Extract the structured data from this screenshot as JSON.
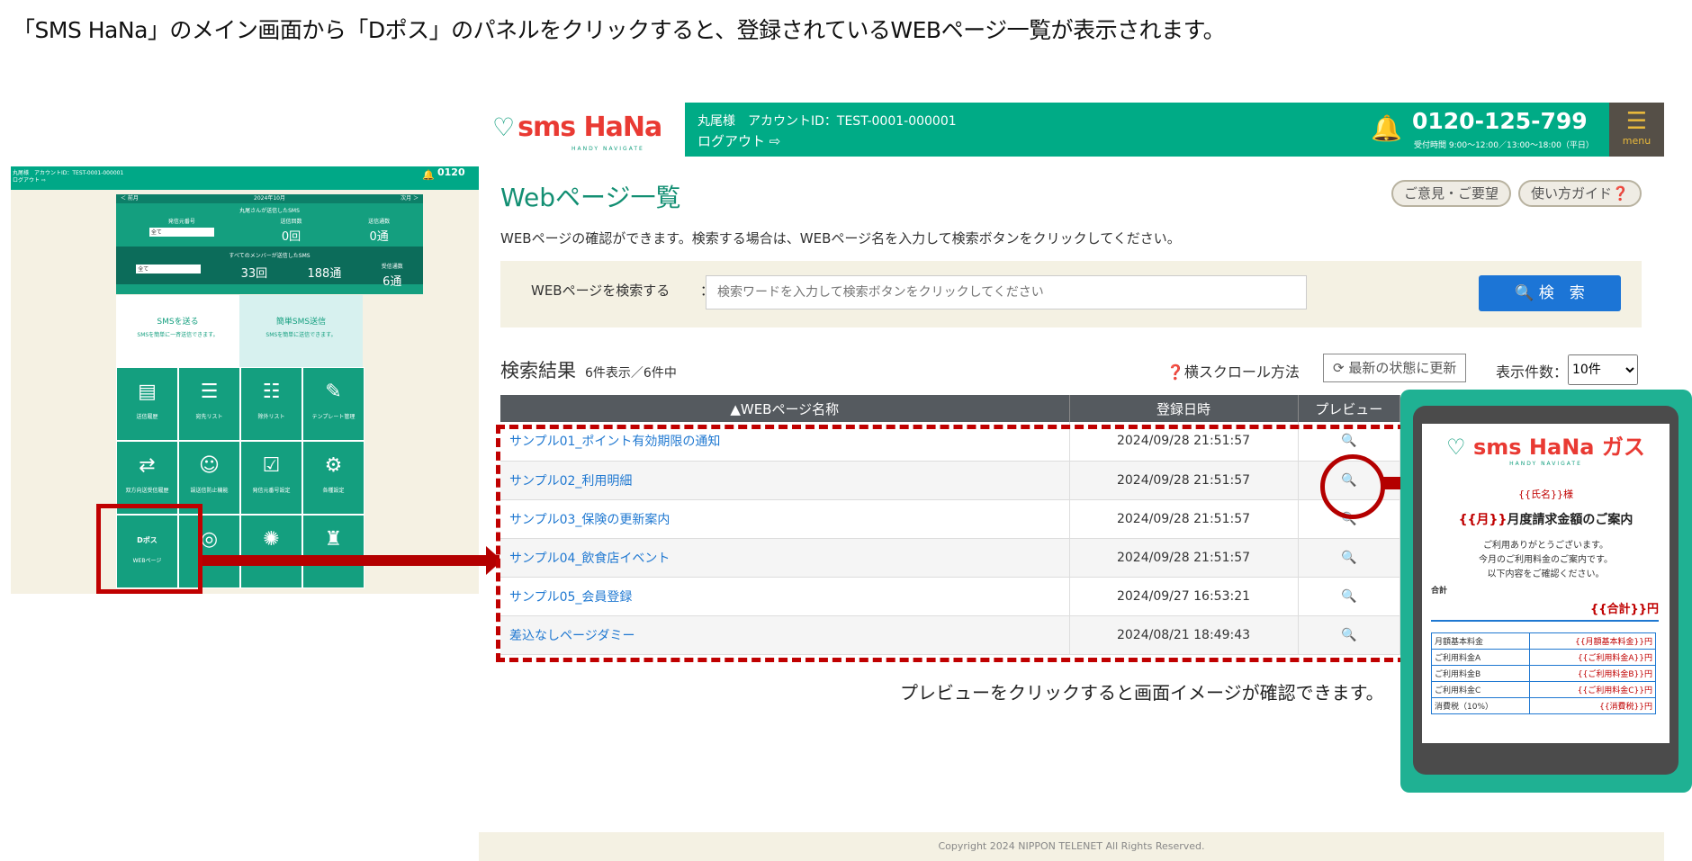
{
  "caption": "「SMS HaNa」のメイン画面から「Dポス」のパネルをクリックすると、登録されているWEBページ一覧が表示されます。",
  "left_panel": {
    "header_line1": "丸尾様　アカウントID：TEST-0001-000001",
    "header_line2": "ログアウト ⇨",
    "tel": "0120",
    "nav_prev": "＜ 前月",
    "nav_month": "2024年10月",
    "nav_next": "次月 ＞",
    "my_sms_title": "丸尾さんが送信したSMS",
    "sender_label": "発信元番号",
    "sender_value": "全て",
    "sent_count_label": "送信回数",
    "sent_count_value": "0回",
    "sent_msgs_label": "送信通数",
    "sent_msgs_value": "0通",
    "all_sms_title": "すべてのメンバーが送信したSMS",
    "all_sender_value": "全て",
    "all_sent_count_value": "33回",
    "all_sent_msgs_value": "188通",
    "all_received_label": "受信通数",
    "all_received_value": "6通",
    "tile_send_sms": "SMSを送る",
    "tile_send_sms_sub": "SMSを簡単に一斉送信できます。",
    "tile_easy_sms": "簡単SMS送信",
    "tile_easy_sms_sub": "SMSを簡単に送信できます。",
    "tiles": [
      "送信履歴",
      "宛先リスト",
      "除外リスト",
      "テンプレート管理",
      "双方向送受信履歴",
      "誤送信防止機能",
      "発信元番号設定",
      "各種設定",
      "WEBページ"
    ],
    "dpos_label": "Dポス"
  },
  "header": {
    "logo_text": "sms HaNa",
    "logo_sub": "HANDY NAVIGATE",
    "account": "丸尾様　アカウントID：TEST-0001-000001",
    "logout": "ログアウト ⇨",
    "tel": "0120-125-799",
    "hours": "受付時間 9:00〜12:00／13:00〜18:00（平日）",
    "menu": "menu"
  },
  "page": {
    "title": "Webページ一覧",
    "feedback_button": "ご意見・ご要望",
    "guide_button": "使い方ガイド❓",
    "description": "WEBページの確認ができます。検索する場合は、WEBページ名を入力して検索ボタンをクリックしてください。",
    "search_label": "WEBページを検索する",
    "search_colon": "：",
    "search_placeholder": "検索ワードを入力して検索ボタンをクリックしてください",
    "search_button": "🔍 検　索",
    "results_title": "検索結果",
    "results_count": "6件表示／6件中",
    "scroll_help": "❓横スクロール方法",
    "refresh_button": "⟳ 最新の状態に更新",
    "per_page_label": "表示件数：",
    "per_page_value": "10件"
  },
  "table": {
    "headers": [
      "▲WEBページ名称",
      "登録日時",
      "プレビュー"
    ],
    "rows": [
      {
        "name": "サンプル01_ポイント有効期限の通知",
        "date": "2024/09/28 21:51:57"
      },
      {
        "name": "サンプル02_利用明細",
        "date": "2024/09/28 21:51:57"
      },
      {
        "name": "サンプル03_保険の更新案内",
        "date": "2024/09/28 21:51:57"
      },
      {
        "name": "サンプル04_飲食店イベント",
        "date": "2024/09/28 21:51:57"
      },
      {
        "name": "サンプル05_会員登録",
        "date": "2024/09/27 16:53:21"
      },
      {
        "name": "差込なしページダミー",
        "date": "2024/08/21 18:49:43"
      }
    ]
  },
  "note": "プレビューをクリックすると画面イメージが確認できます。",
  "phone": {
    "logo": "sms HaNa",
    "logo_suffix": "ガス",
    "logo_sub": "HANDY NAVIGATE",
    "name_line": "{{氏名}}様",
    "title_pre": "{{月}}",
    "title_post": "月度請求金額のご案内",
    "message": [
      "ご利用ありがとうございます。",
      "今月のご利用料金のご案内です。",
      "以下内容をご確認ください。"
    ],
    "total_label": "合計",
    "total_value": "{{合計}}円",
    "items": [
      {
        "label": "月額基本料金",
        "value": "{{月額基本料金}}円"
      },
      {
        "label": "ご利用料金A",
        "value": "{{ご利用料金A}}円"
      },
      {
        "label": "ご利用料金B",
        "value": "{{ご利用料金B}}円"
      },
      {
        "label": "ご利用料金C",
        "value": "{{ご利用料金C}}円"
      },
      {
        "label": "消費税（10%）",
        "value": "{{消費税}}円"
      }
    ]
  },
  "footer": "Copyright 2024 NIPPON TELENET All Rights Reserved.",
  "colors": {
    "brand_green": "#00ab86",
    "accent_red": "#c00000",
    "link_blue": "#1f78d1"
  }
}
